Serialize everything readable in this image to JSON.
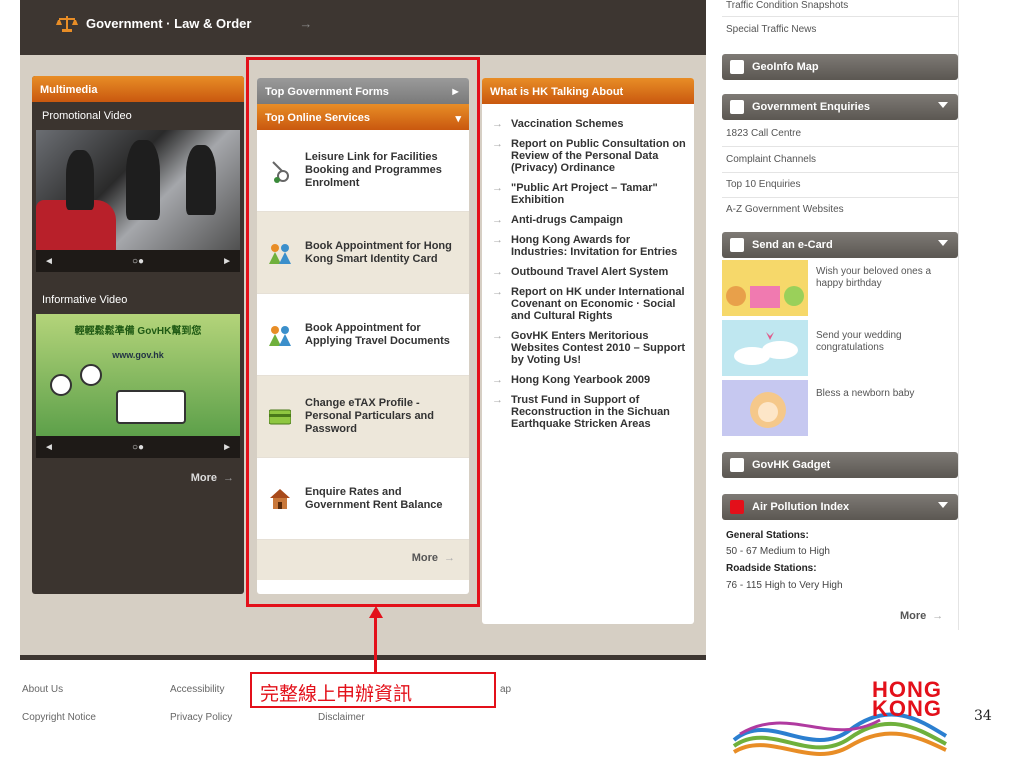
{
  "top_bar": {
    "title": "Government · Law & Order",
    "arrow": "→"
  },
  "multimedia": {
    "header": "Multimedia",
    "promo_label": "Promotional Video",
    "ctrl_left": "◄",
    "ctrl_dots": "○●",
    "ctrl_right": "►",
    "info_label": "Informative Video",
    "info_video_title": "輕輕鬆鬆準備 GovHK幫到您",
    "info_video_url": "www.gov.hk",
    "ctrl2_dots": "○●",
    "more": "More"
  },
  "forms": {
    "header": "Top Government Forms",
    "header_arrow": "►",
    "online_header": "Top Online Services",
    "online_dropdown": "▾",
    "items": [
      {
        "label": "Leisure Link for Facilities Booking and Programmes Enrolment"
      },
      {
        "label": "Book Appointment for Hong Kong Smart Identity Card"
      },
      {
        "label": "Book Appointment for Applying Travel Documents"
      },
      {
        "label": "Change eTAX Profile - Personal Particulars and Password"
      },
      {
        "label": "Enquire Rates and Government Rent Balance"
      }
    ],
    "more": "More"
  },
  "talk": {
    "header": "What is HK Talking About",
    "items": [
      "Vaccination Schemes",
      "Report on Public Consultation on Review of the Personal Data (Privacy) Ordinance",
      "\"Public Art Project – Tamar\" Exhibition",
      "Anti-drugs Campaign",
      "Hong Kong Awards for Industries: Invitation for Entries",
      "Outbound Travel Alert System",
      "Report on HK under International Covenant on Economic · Social and Cultural Rights",
      "GovHK Enters Meritorious Websites Contest 2010 – Support by Voting Us!",
      "Hong Kong Yearbook 2009",
      "Trust Fund in Support of Reconstruction in the Sichuan Earthquake Stricken Areas"
    ]
  },
  "right": {
    "traffic_snapshots": "Traffic Condition Snapshots",
    "special_traffic": "Special Traffic News",
    "geoinfo": "GeoInfo Map",
    "enquiries": "Government Enquiries",
    "enq_links": [
      "1823 Call Centre",
      "Complaint Channels",
      "Top 10 Enquiries",
      "A-Z Government Websites"
    ],
    "ecard": "Send an e-Card",
    "ecards": [
      "Wish your beloved ones a happy birthday",
      "Send your wedding congratulations",
      "Bless a newborn baby"
    ],
    "gadget": "GovHK Gadget",
    "api": "Air Pollution Index",
    "api_general": "General Stations:",
    "api_general_val": "50 - 67 Medium to High",
    "api_road": "Roadside Stations:",
    "api_road_val": "76 - 115 High to Very High",
    "more": "More"
  },
  "footer": {
    "links": [
      "About Us",
      "Accessibility",
      "Copyright Notice",
      "Privacy Policy",
      "Disclaimer",
      "ap"
    ],
    "logo_line1": "HONG",
    "logo_line2": "KONG"
  },
  "annotation": {
    "caption": "完整線上申辦資訊"
  },
  "page_number": "34",
  "colors": {
    "accent": "#e3101a",
    "orange": "#e88d26",
    "dark": "#3d3631"
  }
}
